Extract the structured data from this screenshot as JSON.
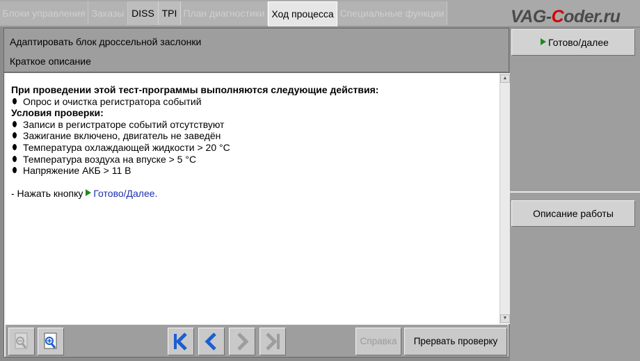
{
  "tabs": [
    {
      "label": "Блоки управления",
      "state": "disabled"
    },
    {
      "label": "Заказы",
      "state": "disabled"
    },
    {
      "label": "DISS",
      "state": "enabled"
    },
    {
      "label": "TPI",
      "state": "enabled"
    },
    {
      "label": "План диагностики",
      "state": "disabled"
    },
    {
      "label": "Ход процесса",
      "state": "active"
    },
    {
      "label": "Специальные функции",
      "state": "disabled"
    }
  ],
  "watermark": {
    "prefix": "VAG-",
    "accent": "C",
    "suffix": "oder.ru"
  },
  "header": {
    "title": "Адаптировать блок дроссельной заслонки",
    "subtitle": "Краткое описание"
  },
  "content": {
    "heading": "При проведении этой тест-программы выполняются следующие действия:",
    "actions": [
      "Опрос и очистка регистратора событий"
    ],
    "conditions_heading": "Условия проверки:",
    "conditions": [
      "Записи в регистраторе событий отсутствуют",
      "Зажигание включено, двигатель не заведён",
      "Температура охлаждающей жидкости > 20 °C",
      "Температура воздуха на впуске > 5 °C",
      "Напряжение АКБ > 11 В"
    ],
    "instruction_prefix": "- Нажать кнопку",
    "instruction_link": "Готово/Далее",
    "instruction_suffix": "."
  },
  "toolbar": {
    "zoom_out_icon": "zoom-out-icon",
    "zoom_in_icon": "zoom-in-icon",
    "help_label": "Справка",
    "abort_label": "Прервать проверку"
  },
  "right": {
    "next_label": "Готово/далее",
    "description_label": "Описание работы"
  },
  "colors": {
    "accent_green": "#1f8a1f",
    "link_blue": "#1d2fb0",
    "nav_blue": "#1a5fd0",
    "watermark_red": "#d40000"
  }
}
